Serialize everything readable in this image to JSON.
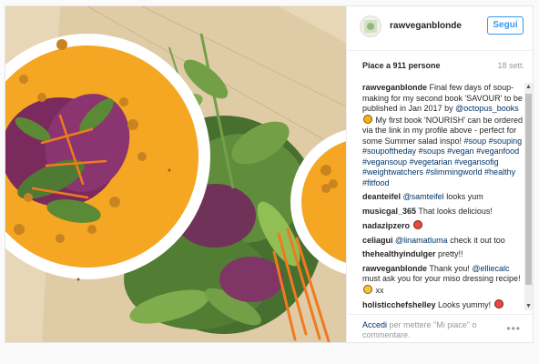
{
  "post": {
    "username": "rawveganblonde",
    "follow_label": "Segui",
    "likes": "Piace a 911 persone",
    "date": "18 sett."
  },
  "comments": [
    {
      "user": "rawveganblonde",
      "parts": [
        {
          "t": "Final few days of soup-making for my second book 'SAVOUR' to be published in Jan 2017 by "
        },
        {
          "t": "@octopus_books",
          "tag": true
        },
        {
          "emoji": "heart-emoji"
        },
        {
          "t": " My first book 'NOURISH' can be ordered via the link in my profile above - perfect for some Summer salad inspo! "
        },
        {
          "t": "#soup #souping #soupoftheday #soups #vegan #veganfood #vegansoup #vegetarian #vegansofig #weightwatchers #slimmingworld #healthy #fitfood",
          "tag": true
        }
      ]
    },
    {
      "user": "deanteifel",
      "parts": [
        {
          "t": "@samteifel",
          "tag": true
        },
        {
          "t": " looks yum"
        }
      ]
    },
    {
      "user": "musicgal_365",
      "parts": [
        {
          "t": "That looks delicious!"
        }
      ]
    },
    {
      "user": "nadazipzero",
      "parts": [
        {
          "emoji": "face-emoji"
        }
      ]
    },
    {
      "user": "celiagui",
      "parts": [
        {
          "t": "@linamatluma",
          "tag": true
        },
        {
          "t": " check it out too"
        }
      ]
    },
    {
      "user": "thehealthyindulger",
      "parts": [
        {
          "t": "pretty!!"
        }
      ]
    },
    {
      "user": "rawveganblonde",
      "parts": [
        {
          "t": "Thank you! "
        },
        {
          "t": "@elliecalc",
          "tag": true
        },
        {
          "t": " must ask you for your miso dressing recipe! "
        },
        {
          "emoji": "grin-emoji"
        },
        {
          "t": " xx"
        }
      ]
    },
    {
      "user": "holisticchefshelley",
      "parts": [
        {
          "t": "Looks yummy! "
        },
        {
          "emoji": "face-emoji"
        }
      ]
    }
  ],
  "footer": {
    "login_link": "Accedi",
    "login_rest": " per mettere \"Mi piace\" o commentare.",
    "more_label": "•••"
  },
  "icons": {
    "scroll_up": "▲",
    "scroll_down": "▼"
  },
  "colors": {
    "accent": "#3897f0",
    "link": "#003569",
    "soup": "#f5a623"
  }
}
